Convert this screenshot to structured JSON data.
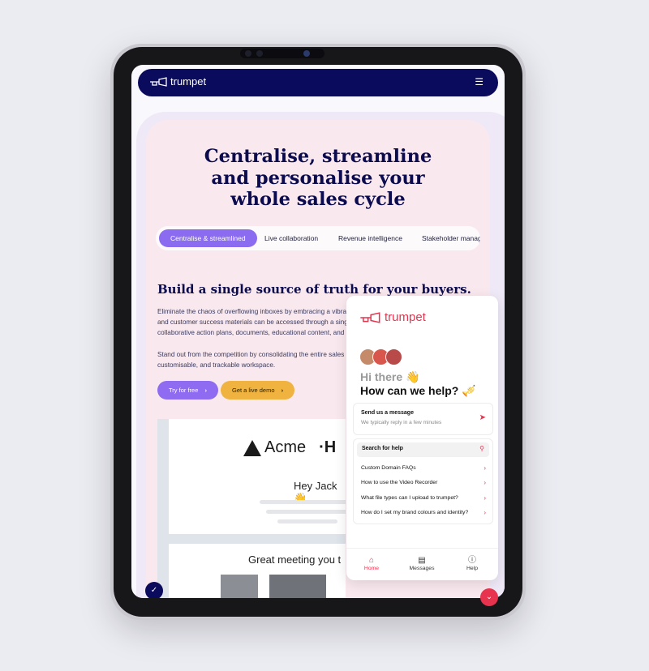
{
  "nav": {
    "brand": "trumpet",
    "menu_icon": "hamburger-icon"
  },
  "hero": {
    "headline_lines": [
      "Centralise, streamline",
      "and personalise your",
      "whole sales cycle"
    ],
    "tabs": [
      "Centralise & streamlined",
      "Live collaboration",
      "Revenue intelligence",
      "Stakeholder manag"
    ],
    "active_tab": 0
  },
  "section": {
    "title": "Build a single source of truth for your buyers.",
    "para1_lines": [
      "Eliminate the chaos of overflowing inboxes by embracing a vibra",
      "and customer success materials can be accessed through a sing",
      "collaborative action plans, documents, educational content, and"
    ],
    "para2_lines": [
      "Stand out from the competition by consolidating the entire sales",
      "customisable, and trackable workspace."
    ],
    "cta_primary": "Try for free",
    "cta_secondary": "Get a live demo"
  },
  "mockup": {
    "brand": "Acme",
    "greeting": "Hey Jack 👋",
    "meeting": "Great meeting you t"
  },
  "widget": {
    "brand": "trumpet",
    "greeting": "Hi there 👋",
    "question": "How can we help? 🎺",
    "message_card": {
      "title": "Send us a message",
      "subtitle": "We typically reply in a few minutes"
    },
    "search_label": "Search for help",
    "faqs": [
      "Custom Domain FAQs",
      "How to use the Video Recorder",
      "What file types can I upload to trumpet?",
      "How do I set my brand colours and identity?"
    ],
    "footer": [
      {
        "label": "Home",
        "icon": "home-icon"
      },
      {
        "label": "Messages",
        "icon": "messages-icon"
      },
      {
        "label": "Help",
        "icon": "help-icon"
      }
    ]
  },
  "colors": {
    "navy": "#0b0b5e",
    "purple": "#8e6bf1",
    "yellow": "#f1b33f",
    "red": "#e8334f",
    "pink_bg": "#f9e9ef"
  }
}
